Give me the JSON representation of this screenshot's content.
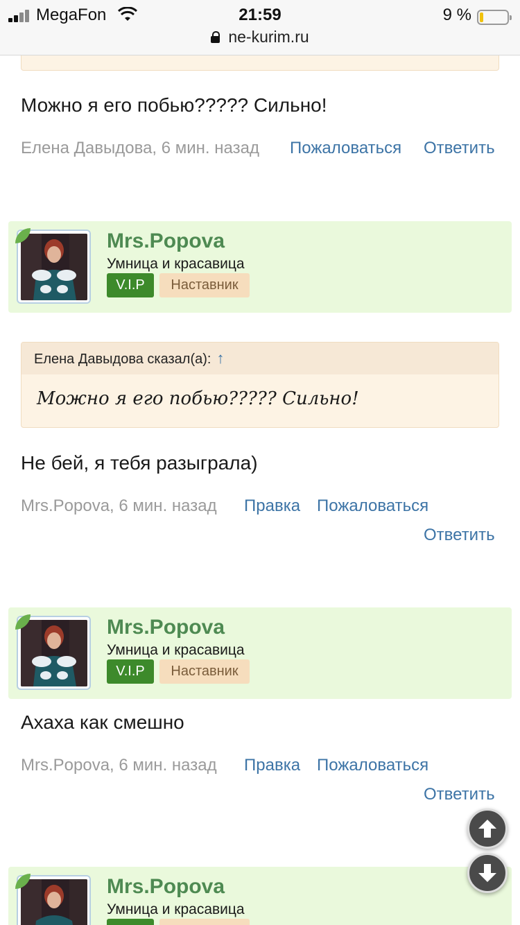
{
  "status_bar": {
    "carrier": "MegaFon",
    "time": "21:59",
    "battery_percent": "9 %",
    "battery_level": 0.09,
    "url": "ne-kurim.ru"
  },
  "posts": [
    {
      "text": "Можно я его побью????? Сильно!",
      "author_time": "Елена Давыдова, 6 мин. назад",
      "report": "Пожаловаться",
      "reply": "Ответить"
    },
    {
      "user": {
        "name": "Mrs.Popova",
        "title": "Умница и красавица",
        "badge_vip": "V.I.P",
        "badge_role": "Наставник"
      },
      "quote": {
        "head": "Елена Давыдова сказал(а):",
        "arrow": "↑",
        "text": "Можно я его побью????? Сильно!"
      },
      "text": "Не бей, я тебя разыграла)",
      "author_time": "Mrs.Popova, 6 мин. назад",
      "edit": "Правка",
      "report": "Пожаловаться",
      "reply": "Ответить"
    },
    {
      "user": {
        "name": "Mrs.Popova",
        "title": "Умница и красавица",
        "badge_vip": "V.I.P",
        "badge_role": "Наставник"
      },
      "text": "Ахаха как смешно",
      "author_time": "Mrs.Popova, 6 мин. назад",
      "edit": "Правка",
      "report": "Пожаловаться",
      "reply": "Ответить"
    },
    {
      "user": {
        "name": "Mrs.Popova",
        "title": "Умница и красавица"
      }
    }
  ],
  "icons": {
    "scroll_up": "arrow-up-icon",
    "scroll_down": "arrow-down-icon",
    "lock": "lock-icon",
    "wifi": "wifi-icon",
    "signal": "signal-icon",
    "battery": "battery-icon"
  },
  "colors": {
    "link": "#3d74a6",
    "username": "#4e8a52",
    "user_card_bg": "#eaf9dc",
    "vip_badge": "#3d8a2b",
    "role_badge": "#f6ddbd",
    "quote_bg": "#fdf3e4"
  }
}
